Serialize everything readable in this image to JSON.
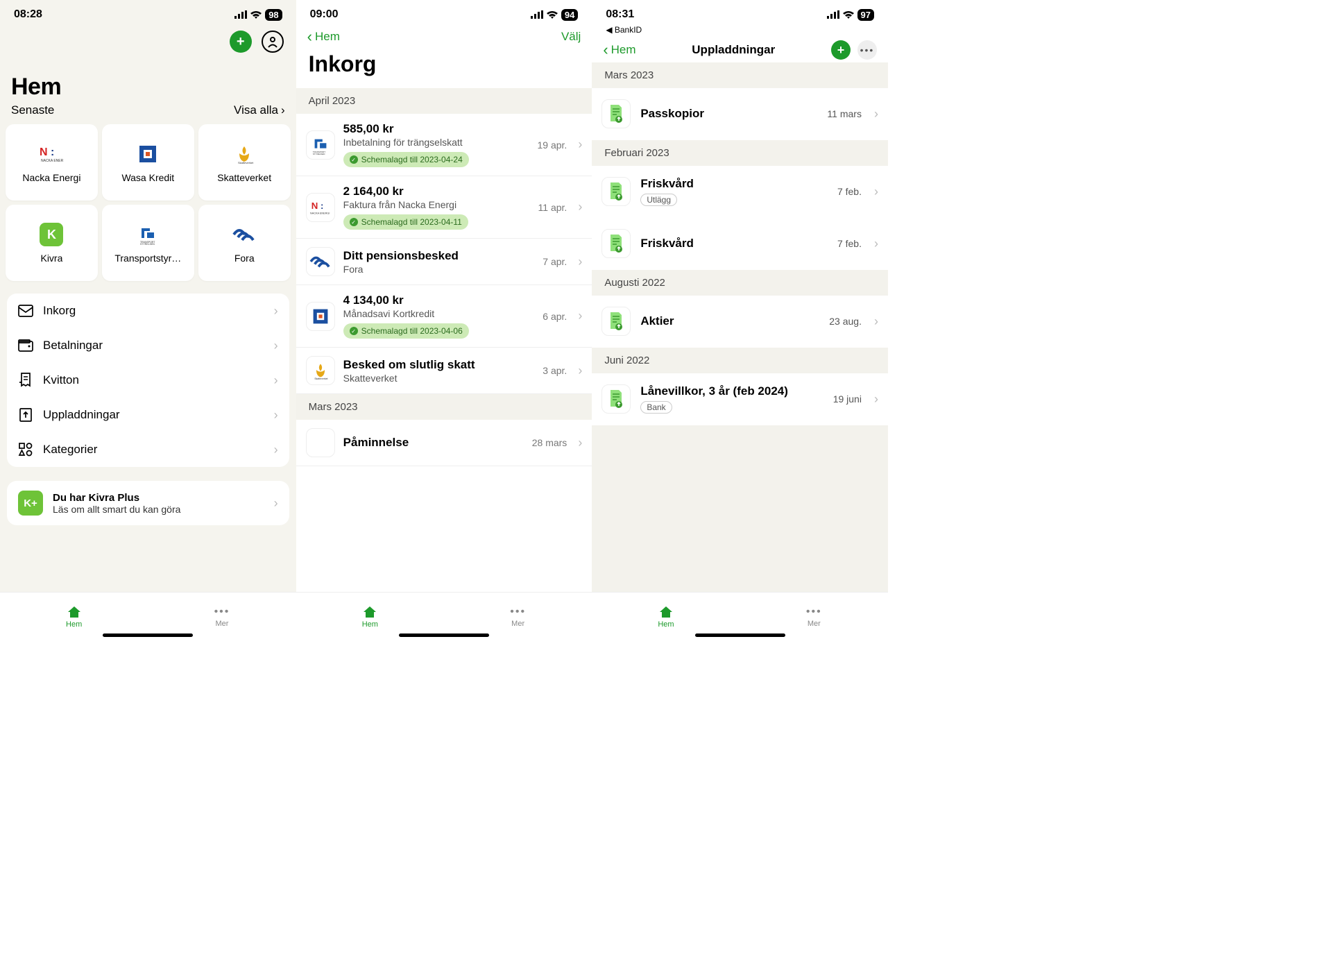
{
  "screen1": {
    "status": {
      "time": "08:28",
      "battery": "98"
    },
    "title": "Hem",
    "subtitle": "Senaste",
    "viewall": "Visa alla",
    "tiles": [
      {
        "label": "Nacka Energi"
      },
      {
        "label": "Wasa Kredit"
      },
      {
        "label": "Skatteverket"
      },
      {
        "label": "Kivra"
      },
      {
        "label": "Transportstyr…"
      },
      {
        "label": "Fora"
      }
    ],
    "menu": [
      {
        "label": "Inkorg"
      },
      {
        "label": "Betalningar"
      },
      {
        "label": "Kvitton"
      },
      {
        "label": "Uppladdningar"
      },
      {
        "label": "Kategorier"
      }
    ],
    "plus": {
      "badge": "K+",
      "title": "Du har Kivra Plus",
      "sub": "Läs om allt smart du kan göra"
    }
  },
  "screen2": {
    "status": {
      "time": "09:00",
      "battery": "94"
    },
    "back": "Hem",
    "action": "Välj",
    "title": "Inkorg",
    "sections": [
      {
        "header": "April 2023",
        "rows": [
          {
            "t1": "585,00 kr",
            "t2": "Inbetalning för trängselskatt",
            "pill": "Schemalagd till 2023-04-24",
            "date": "19 apr."
          },
          {
            "t1": "2 164,00 kr",
            "t2": "Faktura från Nacka Energi",
            "pill": "Schemalagd till 2023-04-11",
            "date": "11 apr."
          },
          {
            "t1": "Ditt pensionsbesked",
            "t2": "Fora",
            "date": "7 apr."
          },
          {
            "t1": "4 134,00 kr",
            "t2": "Månadsavi Kortkredit",
            "pill": "Schemalagd till 2023-04-06",
            "date": "6 apr."
          },
          {
            "t1": "Besked om slutlig skatt",
            "t2": "Skatteverket",
            "date": "3 apr."
          }
        ]
      },
      {
        "header": "Mars 2023",
        "rows": [
          {
            "t1": "Påminnelse",
            "date": "28 mars"
          }
        ]
      }
    ]
  },
  "screen3": {
    "status": {
      "time": "08:31",
      "battery": "97"
    },
    "breadcrumb": "◀ BankID",
    "back": "Hem",
    "title": "Uppladdningar",
    "sections": [
      {
        "header": "Mars 2023",
        "rows": [
          {
            "t1": "Passkopior",
            "date": "11 mars"
          }
        ]
      },
      {
        "header": "Februari 2023",
        "rows": [
          {
            "t1": "Friskvård",
            "tag": "Utlägg",
            "date": "7 feb."
          },
          {
            "t1": "Friskvård",
            "date": "7 feb."
          }
        ]
      },
      {
        "header": "Augusti 2022",
        "rows": [
          {
            "t1": "Aktier",
            "date": "23 aug."
          }
        ]
      },
      {
        "header": "Juni 2022",
        "rows": [
          {
            "t1": "Lånevillkor, 3 år (feb 2024)",
            "tag": "Bank",
            "date": "19 juni"
          }
        ]
      }
    ]
  },
  "tabs": {
    "home": "Hem",
    "more": "Mer"
  }
}
